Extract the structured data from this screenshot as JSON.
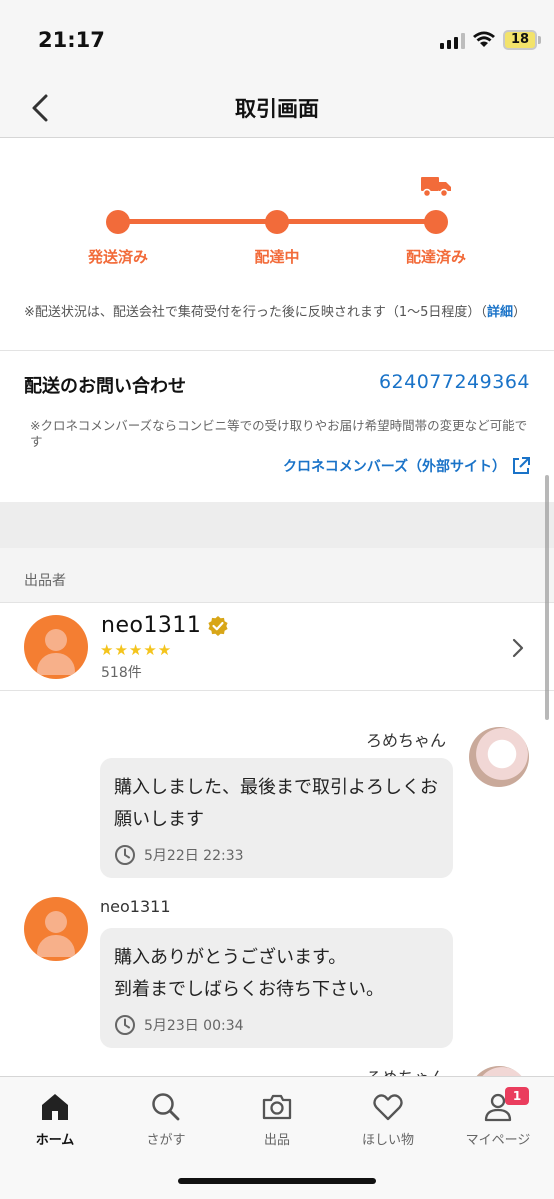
{
  "status_bar": {
    "time": "21:17",
    "battery": "18"
  },
  "header": {
    "title": "取引画面"
  },
  "shipping_progress": {
    "steps": [
      "発送済み",
      "配達中",
      "配達済み"
    ],
    "note": "※配送状況は、配送会社で集荷受付を行った後に反映されます（1〜5日程度）（",
    "note_link": "詳細",
    "note_end": "）"
  },
  "inquiry": {
    "title": "配送のお問い合わせ",
    "tracking_number": "624077249364",
    "note": "※クロネコメンバーズならコンビニ等での受け取りやお届け希望時間帯の変更など可能です",
    "link": "クロネコメンバーズ（外部サイト）"
  },
  "seller": {
    "section_label": "出品者",
    "name": "neo1311",
    "stars": "★★★★★",
    "review_count": "518件"
  },
  "messages": [
    {
      "sender": "ろめちゃん",
      "text": "購入しました、最後まで取引よろしくお願いします",
      "time": "5月22日 22:33"
    },
    {
      "sender": "neo1311",
      "text": "購入ありがとうございます。\n到着までしばらくお待ち下さい。",
      "time": "5月23日 00:34"
    },
    {
      "sender": "ろめちゃん"
    }
  ],
  "tab_bar": {
    "tabs": [
      {
        "label": "ホーム",
        "icon": "home-icon"
      },
      {
        "label": "さがす",
        "icon": "search-icon"
      },
      {
        "label": "出品",
        "icon": "camera-icon"
      },
      {
        "label": "ほしい物",
        "icon": "heart-icon"
      },
      {
        "label": "マイページ",
        "icon": "person-icon"
      }
    ],
    "badge": "1"
  },
  "colors": {
    "accent": "#f26b3a",
    "link": "#1a73c8",
    "star": "#f4c41d",
    "badge": "#ea3d5d"
  }
}
